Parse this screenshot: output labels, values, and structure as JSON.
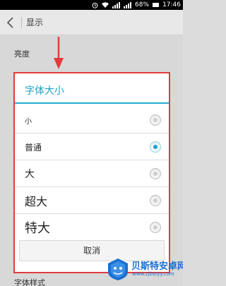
{
  "status_bar": {
    "battery_percent": "68%",
    "time": "17:46",
    "icons": [
      "alarm-icon",
      "wifi-icon",
      "signal-icon",
      "signal-icon",
      "battery-icon"
    ]
  },
  "header": {
    "title": "显示",
    "back_icon": "chevron-left-icon"
  },
  "settings": {
    "brightness_label": "亮度",
    "font_style_label": "字体样式"
  },
  "dialog": {
    "title": "字体大小",
    "options": [
      {
        "label": "小",
        "selected": false
      },
      {
        "label": "普通",
        "selected": true
      },
      {
        "label": "大",
        "selected": false
      },
      {
        "label": "超大",
        "selected": false
      },
      {
        "label": "特大",
        "selected": false
      }
    ],
    "cancel_label": "取消"
  },
  "watermark": {
    "name": "贝斯特安卓网",
    "url": "www.zjbstyy.com"
  },
  "colors": {
    "accent": "#1ba3c4",
    "highlight_border": "#e33b3b",
    "watermark": "#1a6fd1"
  }
}
